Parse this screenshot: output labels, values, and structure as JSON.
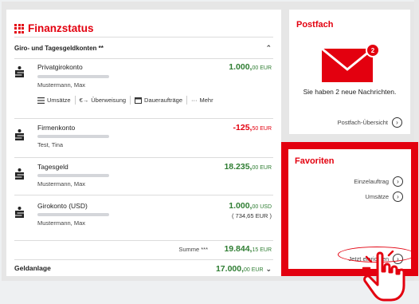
{
  "finanzstatus": {
    "title": "Finanzstatus",
    "section_giro": "Giro- und Tagesgeldkonten **",
    "accounts": [
      {
        "name": "Privatgirokonto",
        "amount_main": "1.000,",
        "amount_cents": "00 EUR",
        "owner": "Mustermann, Max",
        "negative": false
      },
      {
        "name": "Firmenkonto",
        "amount_main": "-125,",
        "amount_cents": "50 EUR",
        "owner": "Test, Tina",
        "negative": true
      },
      {
        "name": "Tagesgeld",
        "amount_main": "18.235,",
        "amount_cents": "00 EUR",
        "owner": "Mustermann, Max",
        "negative": false
      },
      {
        "name": "Girokonto (USD)",
        "amount_main": "1.000,",
        "amount_cents": "00 USD",
        "sub_amount": "( 734,65 EUR )",
        "owner": "Mustermann, Max",
        "negative": false
      }
    ],
    "actions": {
      "umsaetze": "Umsätze",
      "ueberweisung": "Überweisung",
      "dauerauftraege": "Daueraufträge",
      "mehr": "Mehr"
    },
    "summe_label": "Summe ***",
    "summe_main": "19.844,",
    "summe_cents": "15 EUR",
    "geldanlage_label": "Geldanlage",
    "geldanlage_main": "17.000,",
    "geldanlage_cents": "00 EUR"
  },
  "postfach": {
    "title": "Postfach",
    "badge_count": "2",
    "message": "Sie haben 2 neue Nachrichten.",
    "link": "Postfach-Übersicht"
  },
  "favoriten": {
    "title": "Favoriten",
    "links": [
      "Einzelauftrag",
      "Umsätze"
    ],
    "setup_link": "Jetzt einrichten"
  },
  "colors": {
    "brand_red": "#e3000f",
    "positive_green": "#2e7d32"
  }
}
